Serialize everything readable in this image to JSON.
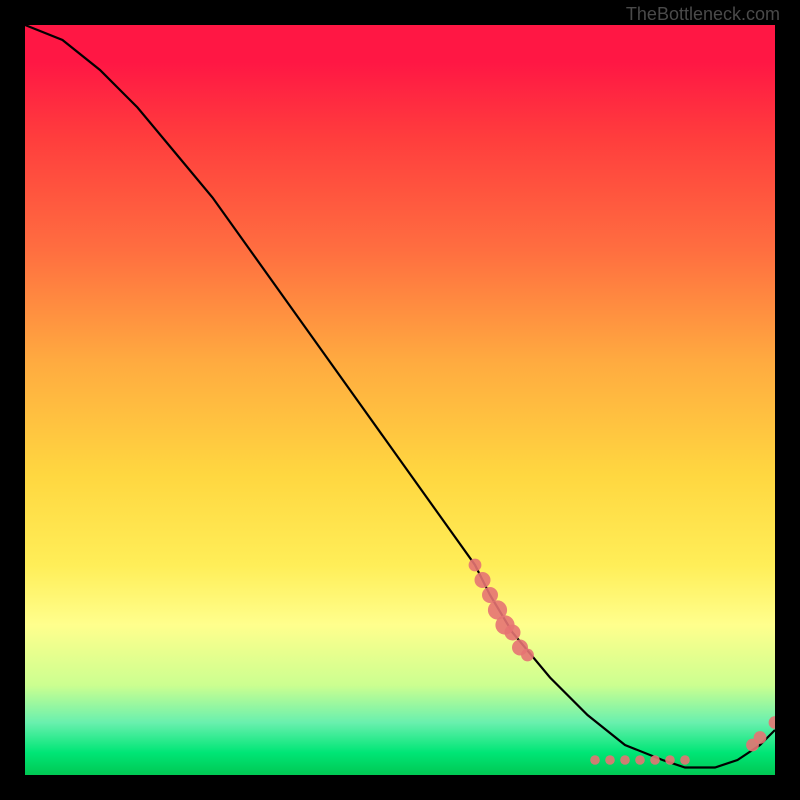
{
  "watermark": "TheBottleneck.com",
  "chart_data": {
    "type": "line",
    "title": "",
    "xlabel": "",
    "ylabel": "",
    "xlim": [
      0,
      100
    ],
    "ylim": [
      0,
      100
    ],
    "curve": {
      "name": "bottleneck-curve",
      "x": [
        0,
        5,
        10,
        15,
        20,
        25,
        30,
        35,
        40,
        45,
        50,
        55,
        60,
        62,
        65,
        70,
        75,
        80,
        85,
        88,
        90,
        92,
        95,
        98,
        100
      ],
      "y": [
        100,
        98,
        94,
        89,
        83,
        77,
        70,
        63,
        56,
        49,
        42,
        35,
        28,
        24,
        19,
        13,
        8,
        4,
        2,
        1,
        1,
        1,
        2,
        4,
        6
      ]
    },
    "markers": [
      {
        "x": 60,
        "y": 28,
        "size": 4
      },
      {
        "x": 61,
        "y": 26,
        "size": 5
      },
      {
        "x": 62,
        "y": 24,
        "size": 5
      },
      {
        "x": 63,
        "y": 22,
        "size": 6
      },
      {
        "x": 64,
        "y": 20,
        "size": 6
      },
      {
        "x": 65,
        "y": 19,
        "size": 5
      },
      {
        "x": 66,
        "y": 17,
        "size": 5
      },
      {
        "x": 67,
        "y": 16,
        "size": 4
      },
      {
        "x": 76,
        "y": 2,
        "size": 3
      },
      {
        "x": 78,
        "y": 2,
        "size": 3
      },
      {
        "x": 80,
        "y": 2,
        "size": 3
      },
      {
        "x": 82,
        "y": 2,
        "size": 3
      },
      {
        "x": 84,
        "y": 2,
        "size": 3
      },
      {
        "x": 86,
        "y": 2,
        "size": 3
      },
      {
        "x": 88,
        "y": 2,
        "size": 3
      },
      {
        "x": 97,
        "y": 4,
        "size": 4
      },
      {
        "x": 98,
        "y": 5,
        "size": 4
      },
      {
        "x": 100,
        "y": 7,
        "size": 4
      }
    ],
    "marker_color": "#e57373",
    "curve_color": "#000000",
    "background_gradient": {
      "type": "vertical",
      "stops": [
        {
          "pos": 0.0,
          "color": "#ff1744"
        },
        {
          "pos": 0.3,
          "color": "#ff6e40"
        },
        {
          "pos": 0.6,
          "color": "#ffd740"
        },
        {
          "pos": 0.8,
          "color": "#ffff8d"
        },
        {
          "pos": 0.93,
          "color": "#69f0ae"
        },
        {
          "pos": 1.0,
          "color": "#00c853"
        }
      ]
    }
  }
}
